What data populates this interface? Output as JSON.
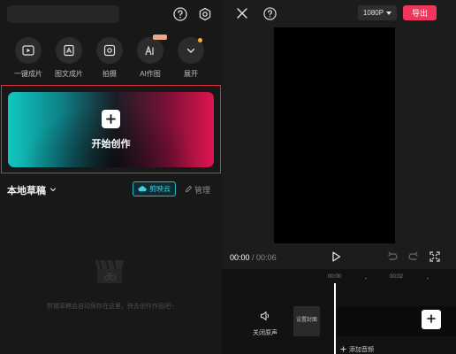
{
  "home": {
    "quick_actions": [
      {
        "label": "一键成片",
        "icon": "play-square-icon"
      },
      {
        "label": "图文成片",
        "icon": "image-text-icon"
      },
      {
        "label": "拍摄",
        "icon": "camera-icon"
      },
      {
        "label": "AI作图",
        "icon": "ai-image-icon"
      },
      {
        "label": "展开",
        "icon": "chevron-down-icon"
      }
    ],
    "create_label": "开始创作",
    "drafts_title": "本地草稿",
    "cloud_label": "剪映云",
    "manage_label": "管理",
    "empty_text": "剪辑草稿会自动保存在这里，快去创作作品吧~"
  },
  "editor": {
    "resolution": "1080P",
    "export_label": "导出",
    "current_time": "00:00",
    "total_time": "/ 00:06",
    "ticks": [
      "00:00",
      "00:02"
    ],
    "mute_label": "关闭原声",
    "cover_label": "设置封面",
    "add_audio_label": "添加音频"
  },
  "colors": {
    "accent_red": "#f0365b",
    "cloud_cyan": "#3fd0e3",
    "highlight_border": "#d6303d"
  }
}
